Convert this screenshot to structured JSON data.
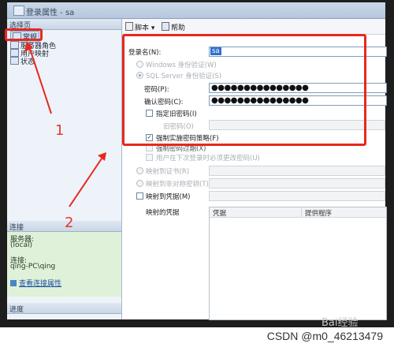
{
  "window": {
    "title": "登录属性 - sa"
  },
  "left": {
    "select_page_header": "选择页",
    "pages": [
      {
        "label": "常规",
        "selected": true
      },
      {
        "label": "服务器角色",
        "selected": false
      },
      {
        "label": "用户映射",
        "selected": false
      },
      {
        "label": "状态",
        "selected": false
      }
    ],
    "connection_header": "连接",
    "server_label": "服务器:",
    "server_value": "(local)",
    "conn_label": "连接:",
    "conn_value": "qing-PC\\qing",
    "view_conn_link": "查看连接属性",
    "progress_header": "进度"
  },
  "toolbar": {
    "script_label": "脚本",
    "help_label": "帮助"
  },
  "form": {
    "login_name_label": "登录名(N):",
    "login_name_value": "sa",
    "windows_auth": "Windows 身份验证(W)",
    "sql_auth": "SQL Server 身份验证(S)",
    "password_label": "密码(P):",
    "password_value": "●●●●●●●●●●●●●●●",
    "confirm_label": "确认密码(C):",
    "confirm_value": "●●●●●●●●●●●●●●●",
    "specify_old": "指定旧密码(I)",
    "old_password_label": "旧密码(O)",
    "enforce_policy": "强制实施密码策略(F)",
    "enforce_expiration": "强制密码过期(X)",
    "must_change": "用户在下次登录时必须更改密码(U)",
    "map_cert": "映射到证书(R)",
    "map_asym": "映射到非对称密钥(T)",
    "map_cred": "映射到凭据(M)",
    "mapped_cred_label": "映射的凭据",
    "col_credential": "凭据",
    "col_provider": "提供程序"
  },
  "annotations": {
    "marker_1": "1",
    "marker_2": "2"
  },
  "watermark": {
    "csdn": "CSDN @m0_46213479",
    "baidu": "Bai经验"
  },
  "colors": {
    "annotation_red": "#e8281e",
    "connection_bg": "#dff1d8"
  }
}
